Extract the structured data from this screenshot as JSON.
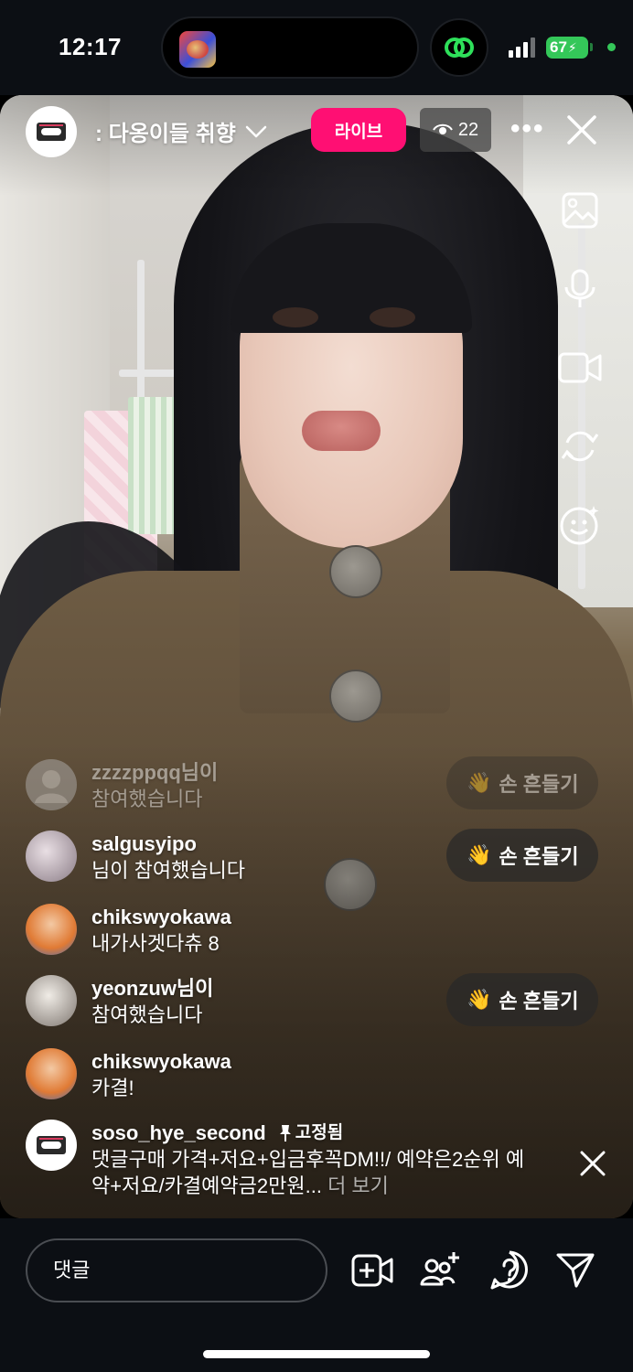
{
  "status_bar": {
    "time": "12:17",
    "battery": "67"
  },
  "live": {
    "host_name": ": 다옹이들 취향",
    "live_label": "라이브",
    "viewer_count": "22"
  },
  "right_tools": [
    "image-icon",
    "microphone-icon",
    "video-camera-icon",
    "flip-camera-icon",
    "face-effects-icon"
  ],
  "chat": {
    "join_1": {
      "user": "zzzzppqq님이",
      "text": "참여했습니다"
    },
    "join_2": {
      "user": "salgusyipo",
      "text": "님이 참여했습니다"
    },
    "msg_1": {
      "user": "chikswyokawa",
      "text": "내가사겟다츄 8"
    },
    "join_3": {
      "user": "yeonzuw님이",
      "text": "참여했습니다"
    },
    "msg_2": {
      "user": "chikswyokawa",
      "text": "카결!"
    },
    "pinned": {
      "user": "soso_hye_second",
      "pinned_label": "고정됨",
      "text_line1": "댓글구매 가격+저요+입금후꼭DM!!/ 예약은2순위 예",
      "text_line2": "약+저요/카결예약금2만원...",
      "more": "더 보기"
    }
  },
  "wave_button": {
    "emoji": "👋",
    "label": "손 흔들기"
  },
  "bottom_bar": {
    "comment_placeholder": "댓글"
  }
}
